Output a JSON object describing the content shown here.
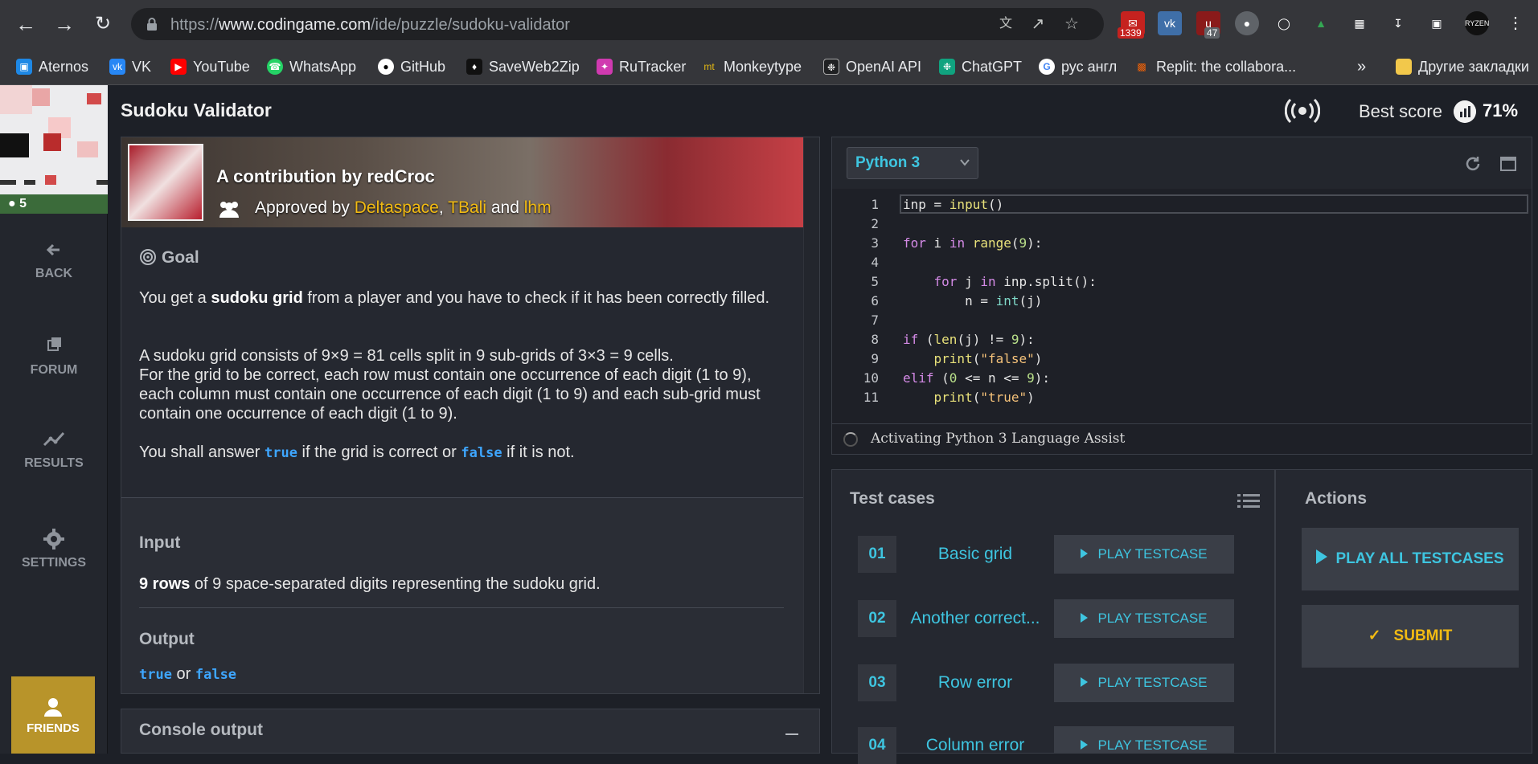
{
  "browser": {
    "url_scheme": "https://",
    "url_host": "www.codingame.com",
    "url_path": "/ide/puzzle/sudoku-validator",
    "extensions": {
      "mail_badge": "1339",
      "ublock_badge": "47"
    },
    "bookmarks": [
      {
        "label": "Aternos",
        "icon": "aternos-icon",
        "color": "#1e88e5"
      },
      {
        "label": "VK",
        "icon": "vk-icon",
        "color": "#2787f5"
      },
      {
        "label": "YouTube",
        "icon": "youtube-icon",
        "color": "#ff0000"
      },
      {
        "label": "WhatsApp",
        "icon": "whatsapp-icon",
        "color": "#25d366"
      },
      {
        "label": "GitHub",
        "icon": "github-icon",
        "color": "#ffffff"
      },
      {
        "label": "SaveWeb2Zip",
        "icon": "saveweb2zip-icon",
        "color": "#111111"
      },
      {
        "label": "RuTracker",
        "icon": "rutracker-icon",
        "color": "#d03ab0"
      },
      {
        "label": "Monkeytype",
        "icon": "monkeytype-icon",
        "color": "#e2b714"
      },
      {
        "label": "OpenAI API",
        "icon": "openai-icon",
        "color": "#202123"
      },
      {
        "label": "ChatGPT",
        "icon": "chatgpt-icon",
        "color": "#10a37f"
      },
      {
        "label": "рус англ",
        "icon": "google-icon",
        "color": "#4285f4"
      },
      {
        "label": "Replit: the collabora...",
        "icon": "replit-icon",
        "color": "#f26207"
      }
    ],
    "more_label": "»",
    "other_bookmarks": "Другие закладки"
  },
  "sidebar": {
    "level": "5",
    "items": [
      {
        "label": "BACK",
        "icon": "back-arrow-icon"
      },
      {
        "label": "FORUM",
        "icon": "forum-icon"
      },
      {
        "label": "RESULTS",
        "icon": "results-icon"
      },
      {
        "label": "SETTINGS",
        "icon": "gear-icon"
      }
    ],
    "friends": "FRIENDS"
  },
  "topbar": {
    "title": "Sudoku Validator",
    "best_score_label": "Best score",
    "best_score_value": "71%"
  },
  "statement": {
    "contribution": "A contribution by redCroc",
    "approved_by": "Approved by",
    "approvers": [
      "Deltaspace",
      "TBali",
      "lhm"
    ],
    "approver_sep": ",",
    "approver_and": "and",
    "goal_title": "Goal",
    "p1_pre": "You get a ",
    "p1_bold": "sudoku grid",
    "p1_post": " from a player and you have to check if it has been correctly filled.",
    "p2_line1": "A sudoku grid consists of 9×9 = 81 cells split in 9 sub-grids of 3×3 = 9 cells.",
    "p2_line2": "For the grid to be correct, each row must contain one occurrence of each digit (1 to 9), each column must contain one occurrence of each digit (1 to 9) and each sub-grid must contain one occurrence of each digit (1 to 9).",
    "p3_pre": "You shall answer ",
    "p3_true": "true",
    "p3_mid": " if the grid is correct or ",
    "p3_false": "false",
    "p3_post": " if it is not.",
    "input_title": "Input",
    "input_bold": "9 rows",
    "input_rest": " of 9 space-separated digits representing the sudoku grid.",
    "output_title": "Output",
    "output_true": "true",
    "output_or": " or ",
    "output_false": "false"
  },
  "console": {
    "title": "Console output"
  },
  "editor": {
    "language": "Python 3",
    "status": "Activating Python 3 Language Assist",
    "lines": [
      "1",
      "2",
      "3",
      "4",
      "5",
      "6",
      "7",
      "8",
      "9",
      "10",
      "11"
    ]
  },
  "tests": {
    "title": "Test cases",
    "play_label": "PLAY TESTCASE",
    "items": [
      {
        "num": "01",
        "name": "Basic grid"
      },
      {
        "num": "02",
        "name": "Another correct..."
      },
      {
        "num": "03",
        "name": "Row error"
      },
      {
        "num": "04",
        "name": "Column error"
      }
    ]
  },
  "actions": {
    "title": "Actions",
    "play_all": "PLAY ALL TESTCASES",
    "submit": "SUBMIT"
  },
  "colors": {
    "accent_cyan": "#3ec5e0",
    "accent_gold": "#f2bb13",
    "friends_bg": "#b8942a",
    "level_bg": "#3b6b3a"
  }
}
